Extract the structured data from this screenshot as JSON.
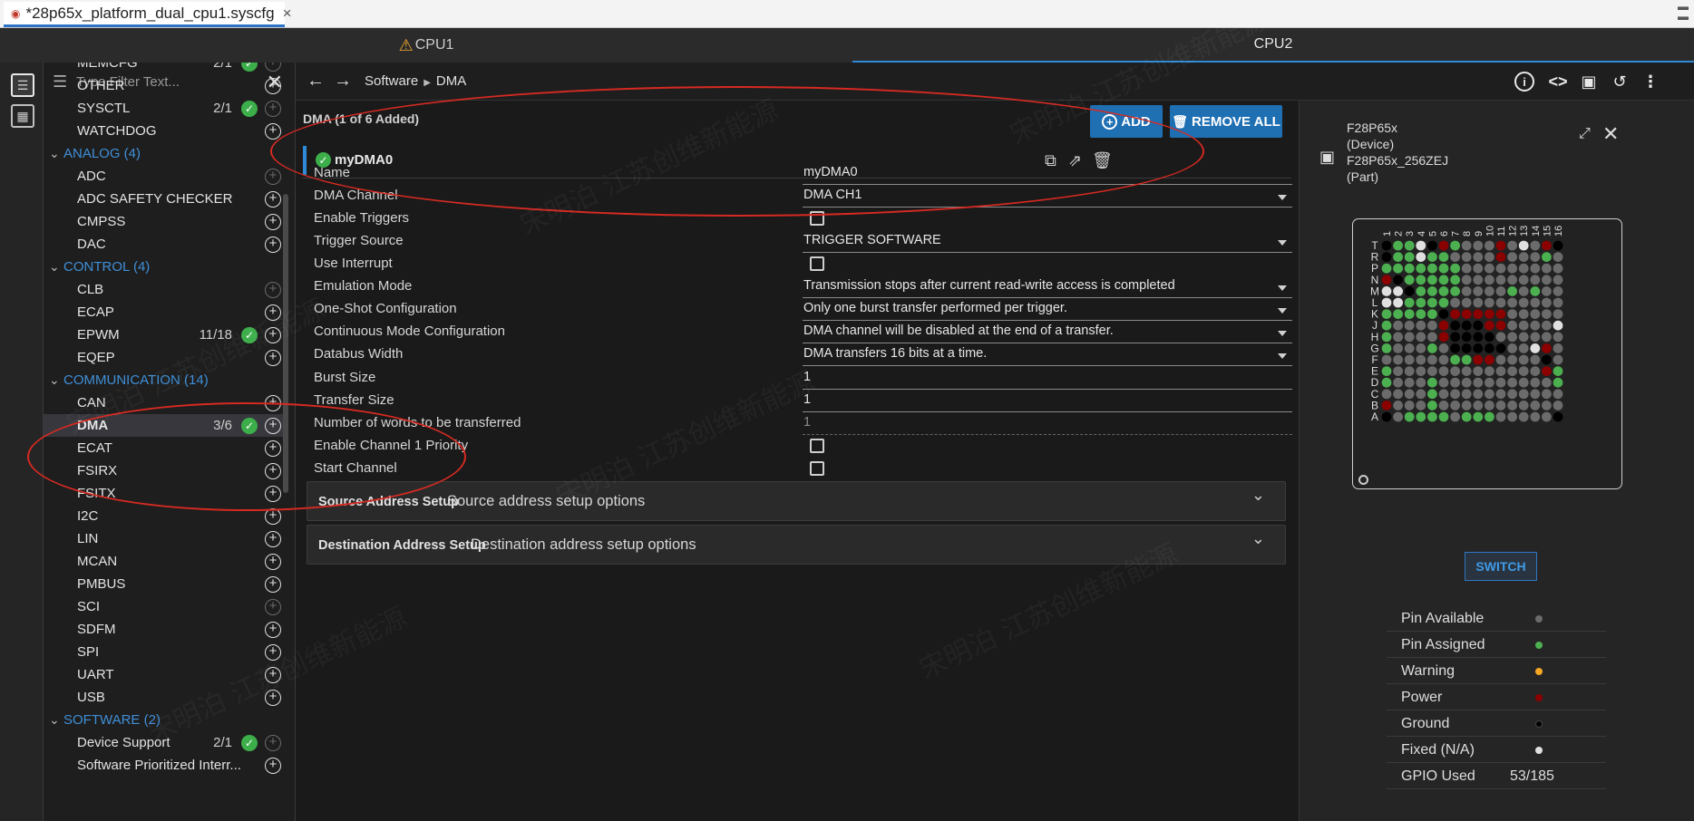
{
  "file_tab": {
    "title": "*28p65x_platform_dual_cpu1.syscfg",
    "close": "×"
  },
  "cpu_tabs": [
    {
      "label": "CPU1",
      "warning": true
    },
    {
      "label": "CPU2",
      "active": true
    }
  ],
  "filter": {
    "placeholder": "Type Filter Text..."
  },
  "tree": [
    {
      "type": "module",
      "label": "MEMCFG",
      "count": "2/1",
      "ok": true,
      "plus_dim": true
    },
    {
      "type": "module",
      "label": "OTHER"
    },
    {
      "type": "module",
      "label": "SYSCTL",
      "count": "2/1",
      "ok": true,
      "plus_dim": true
    },
    {
      "type": "module",
      "label": "WATCHDOG"
    },
    {
      "type": "category",
      "label": "ANALOG (4)"
    },
    {
      "type": "module",
      "label": "ADC",
      "plus_dim": true
    },
    {
      "type": "module",
      "label": "ADC SAFETY CHECKER"
    },
    {
      "type": "module",
      "label": "CMPSS"
    },
    {
      "type": "module",
      "label": "DAC"
    },
    {
      "type": "category",
      "label": "CONTROL (4)"
    },
    {
      "type": "module",
      "label": "CLB",
      "plus_dim": true
    },
    {
      "type": "module",
      "label": "ECAP"
    },
    {
      "type": "module",
      "label": "EPWM",
      "count": "11/18",
      "ok": true
    },
    {
      "type": "module",
      "label": "EQEP"
    },
    {
      "type": "category",
      "label": "COMMUNICATION (14)"
    },
    {
      "type": "module",
      "label": "CAN"
    },
    {
      "type": "module",
      "label": "DMA",
      "count": "3/6",
      "ok": true,
      "selected": true
    },
    {
      "type": "module",
      "label": "ECAT"
    },
    {
      "type": "module",
      "label": "FSIRX"
    },
    {
      "type": "module",
      "label": "FSITX"
    },
    {
      "type": "module",
      "label": "I2C"
    },
    {
      "type": "module",
      "label": "LIN"
    },
    {
      "type": "module",
      "label": "MCAN"
    },
    {
      "type": "module",
      "label": "PMBUS"
    },
    {
      "type": "module",
      "label": "SCI",
      "plus_dim": true
    },
    {
      "type": "module",
      "label": "SDFM"
    },
    {
      "type": "module",
      "label": "SPI"
    },
    {
      "type": "module",
      "label": "UART"
    },
    {
      "type": "module",
      "label": "USB"
    },
    {
      "type": "category",
      "label": "SOFTWARE (2)"
    },
    {
      "type": "module",
      "label": "Device Support",
      "count": "2/1",
      "ok": true,
      "plus_dim": true
    },
    {
      "type": "module",
      "label": "Software Prioritized Interr..."
    }
  ],
  "breadcrumb": {
    "first": "Software",
    "second": "DMA"
  },
  "main": {
    "header": "DMA (1 of 6 Added)",
    "add_label": "ADD",
    "remove_all_label": "REMOVE ALL",
    "instance_name": "myDMA0",
    "fields": [
      {
        "label": "Name",
        "kind": "text",
        "value": "myDMA0"
      },
      {
        "label": "DMA Channel",
        "kind": "select",
        "value": "DMA CH1"
      },
      {
        "label": "Enable Triggers",
        "kind": "checkbox"
      },
      {
        "label": "Trigger Source",
        "kind": "select",
        "value": "TRIGGER SOFTWARE"
      },
      {
        "label": "Use Interrupt",
        "kind": "checkbox"
      },
      {
        "label": "Emulation Mode",
        "kind": "select",
        "value": "Transmission stops after current read-write access is completed"
      },
      {
        "label": "One-Shot Configuration",
        "kind": "select",
        "value": "Only one burst transfer performed per trigger."
      },
      {
        "label": "Continuous Mode Configuration",
        "kind": "select",
        "value": "DMA channel will be disabled at the end of a transfer."
      },
      {
        "label": "Databus Width",
        "kind": "select",
        "value": "DMA transfers 16 bits at a time."
      },
      {
        "label": "Burst Size",
        "kind": "text",
        "value": "1"
      },
      {
        "label": "Transfer Size",
        "kind": "text",
        "value": "1"
      },
      {
        "label": "Number of words to be transferred",
        "kind": "readonly",
        "value": "1"
      },
      {
        "label": "Enable Channel 1 Priority",
        "kind": "checkbox"
      },
      {
        "label": "Start Channel",
        "kind": "checkbox"
      }
    ],
    "sections": [
      {
        "title": "Source Address Setup",
        "desc": "Source address setup options"
      },
      {
        "title": "Destination Address Setup",
        "desc": "Destination address setup options"
      }
    ]
  },
  "device": {
    "line1": "F28P65x",
    "line2": "(Device)",
    "line3": "F28P65x_256ZEJ",
    "line4": "(Part)"
  },
  "pinmap": {
    "cols": [
      "1",
      "2",
      "3",
      "4",
      "5",
      "6",
      "7",
      "8",
      "9",
      "10",
      "11",
      "12",
      "13",
      "14",
      "15",
      "16"
    ],
    "rows": [
      "T",
      "R",
      "P",
      "N",
      "M",
      "L",
      "K",
      "J",
      "H",
      "G",
      "F",
      "E",
      "D",
      "C",
      "B",
      "A"
    ]
  },
  "switch_label": "SWITCH",
  "legend": [
    {
      "label": "Pin Available",
      "color": "#6b6b6b"
    },
    {
      "label": "Pin Assigned",
      "color": "#4caf50"
    },
    {
      "label": "Warning",
      "color": "#f5a623"
    },
    {
      "label": "Power",
      "color": "#8b0000"
    },
    {
      "label": "Ground",
      "color": "#000000"
    },
    {
      "label": "Fixed (N/A)",
      "color": "#e0e0e0"
    },
    {
      "label": "GPIO Used",
      "value": "53/185"
    }
  ],
  "colors": {
    "accent": "#1f6fb3",
    "category": "#3f8fd8",
    "ok": "#3cae4a",
    "annotation": "#d62a22"
  }
}
